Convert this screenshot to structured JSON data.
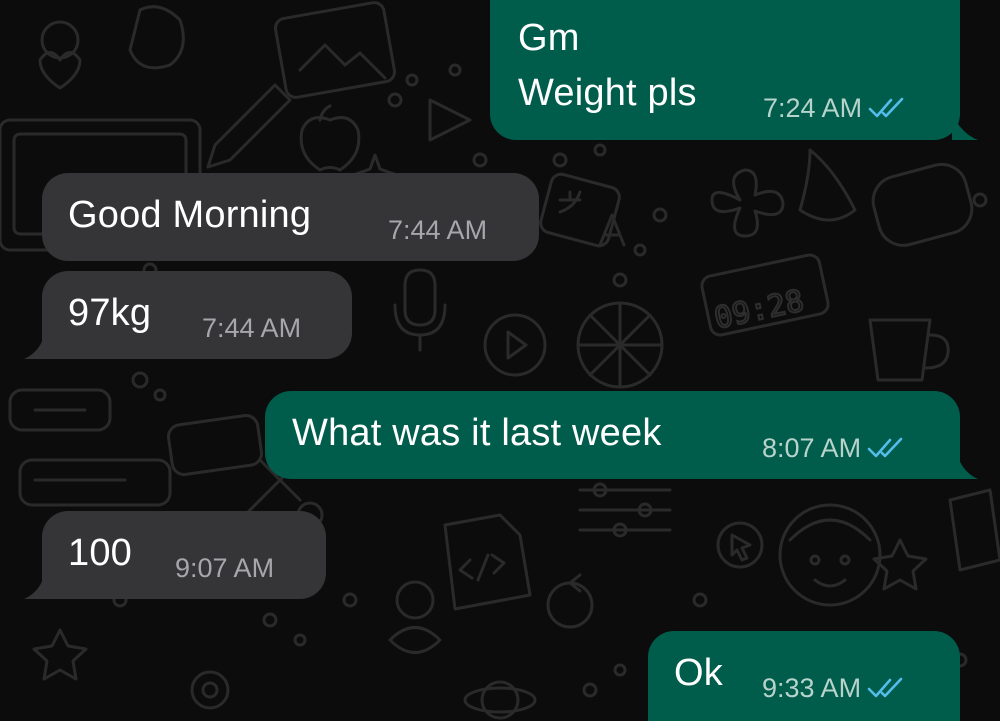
{
  "conversation": {
    "messages": [
      {
        "direction": "outgoing",
        "lines": [
          "Gm",
          "Weight pls"
        ],
        "time": "7:24 AM",
        "status": "read"
      },
      {
        "direction": "incoming",
        "lines": [
          "Good Morning"
        ],
        "time": "7:44 AM"
      },
      {
        "direction": "incoming",
        "lines": [
          "97kg"
        ],
        "time": "7:44 AM"
      },
      {
        "direction": "outgoing",
        "lines": [
          "What was it last week"
        ],
        "time": "8:07 AM",
        "status": "read"
      },
      {
        "direction": "incoming",
        "lines": [
          "100"
        ],
        "time": "9:07 AM"
      },
      {
        "direction": "outgoing",
        "lines": [
          "Ok"
        ],
        "time": "9:33 AM",
        "status": "read"
      }
    ]
  },
  "background": {
    "clock_doodle_text": "09:28"
  },
  "colors": {
    "outgoing_bubble": "#005c4b",
    "incoming_bubble": "#353538",
    "read_ticks": "#53bdeb",
    "background": "#0c0c0c"
  },
  "icons": {
    "read_receipt": "double-check-icon"
  }
}
